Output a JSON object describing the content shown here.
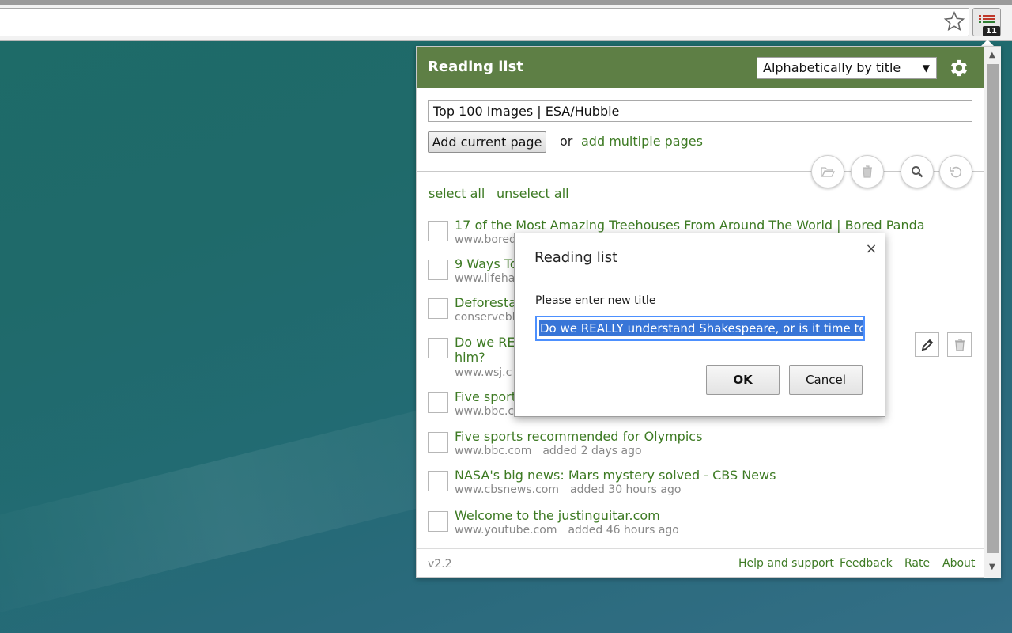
{
  "browser": {
    "extension_badge": "11",
    "icons": {
      "bookmark": "star-icon",
      "extension": "reading-list-icon"
    }
  },
  "popup": {
    "title": "Reading list",
    "sort": {
      "selected": "Alphabetically by title"
    },
    "title_input_value": "Top 100 Images | ESA/Hubble",
    "add_button": "Add current page",
    "or_text": "or",
    "add_multiple": "add multiple pages",
    "toolbar_icons": [
      "folder-open-icon",
      "trash-icon",
      "search-icon",
      "undo-icon"
    ],
    "select_all": "select all",
    "unselect_all": "unselect all",
    "items": [
      {
        "title": "17 of the Most Amazing Treehouses From Around The World | Bored Panda",
        "domain": "www.bored",
        "added": ""
      },
      {
        "title": "9 Ways To",
        "domain": "www.lifeha",
        "added": ""
      },
      {
        "title": "Deforestat",
        "domain": "conservebl",
        "added": ""
      },
      {
        "title": "Do we REA",
        "title2": "him?",
        "domain": "www.wsj.c",
        "added": ""
      },
      {
        "title": "Five sports",
        "domain": "www.bbc.c",
        "added": ""
      },
      {
        "title": "Five sports recommended for Olympics",
        "domain": "www.bbc.com",
        "added": "added 2 days ago"
      },
      {
        "title": "NASA's big news: Mars mystery solved - CBS News",
        "domain": "www.cbsnews.com",
        "added": "added 30 hours ago"
      },
      {
        "title": "Welcome to the justinguitar.com",
        "domain": "www.youtube.com",
        "added": "added 46 hours ago"
      }
    ],
    "footer": {
      "version": "v2.2",
      "links": [
        "Help and support",
        "Feedback",
        "Rate",
        "About"
      ]
    },
    "accent_color": "#5e7f45",
    "link_color": "#3d7a23"
  },
  "dialog": {
    "title": "Reading list",
    "close": "×",
    "label": "Please enter new title",
    "input_value": "Do we REALLY understand Shakespeare, or is it time to start",
    "ok": "OK",
    "cancel": "Cancel"
  }
}
